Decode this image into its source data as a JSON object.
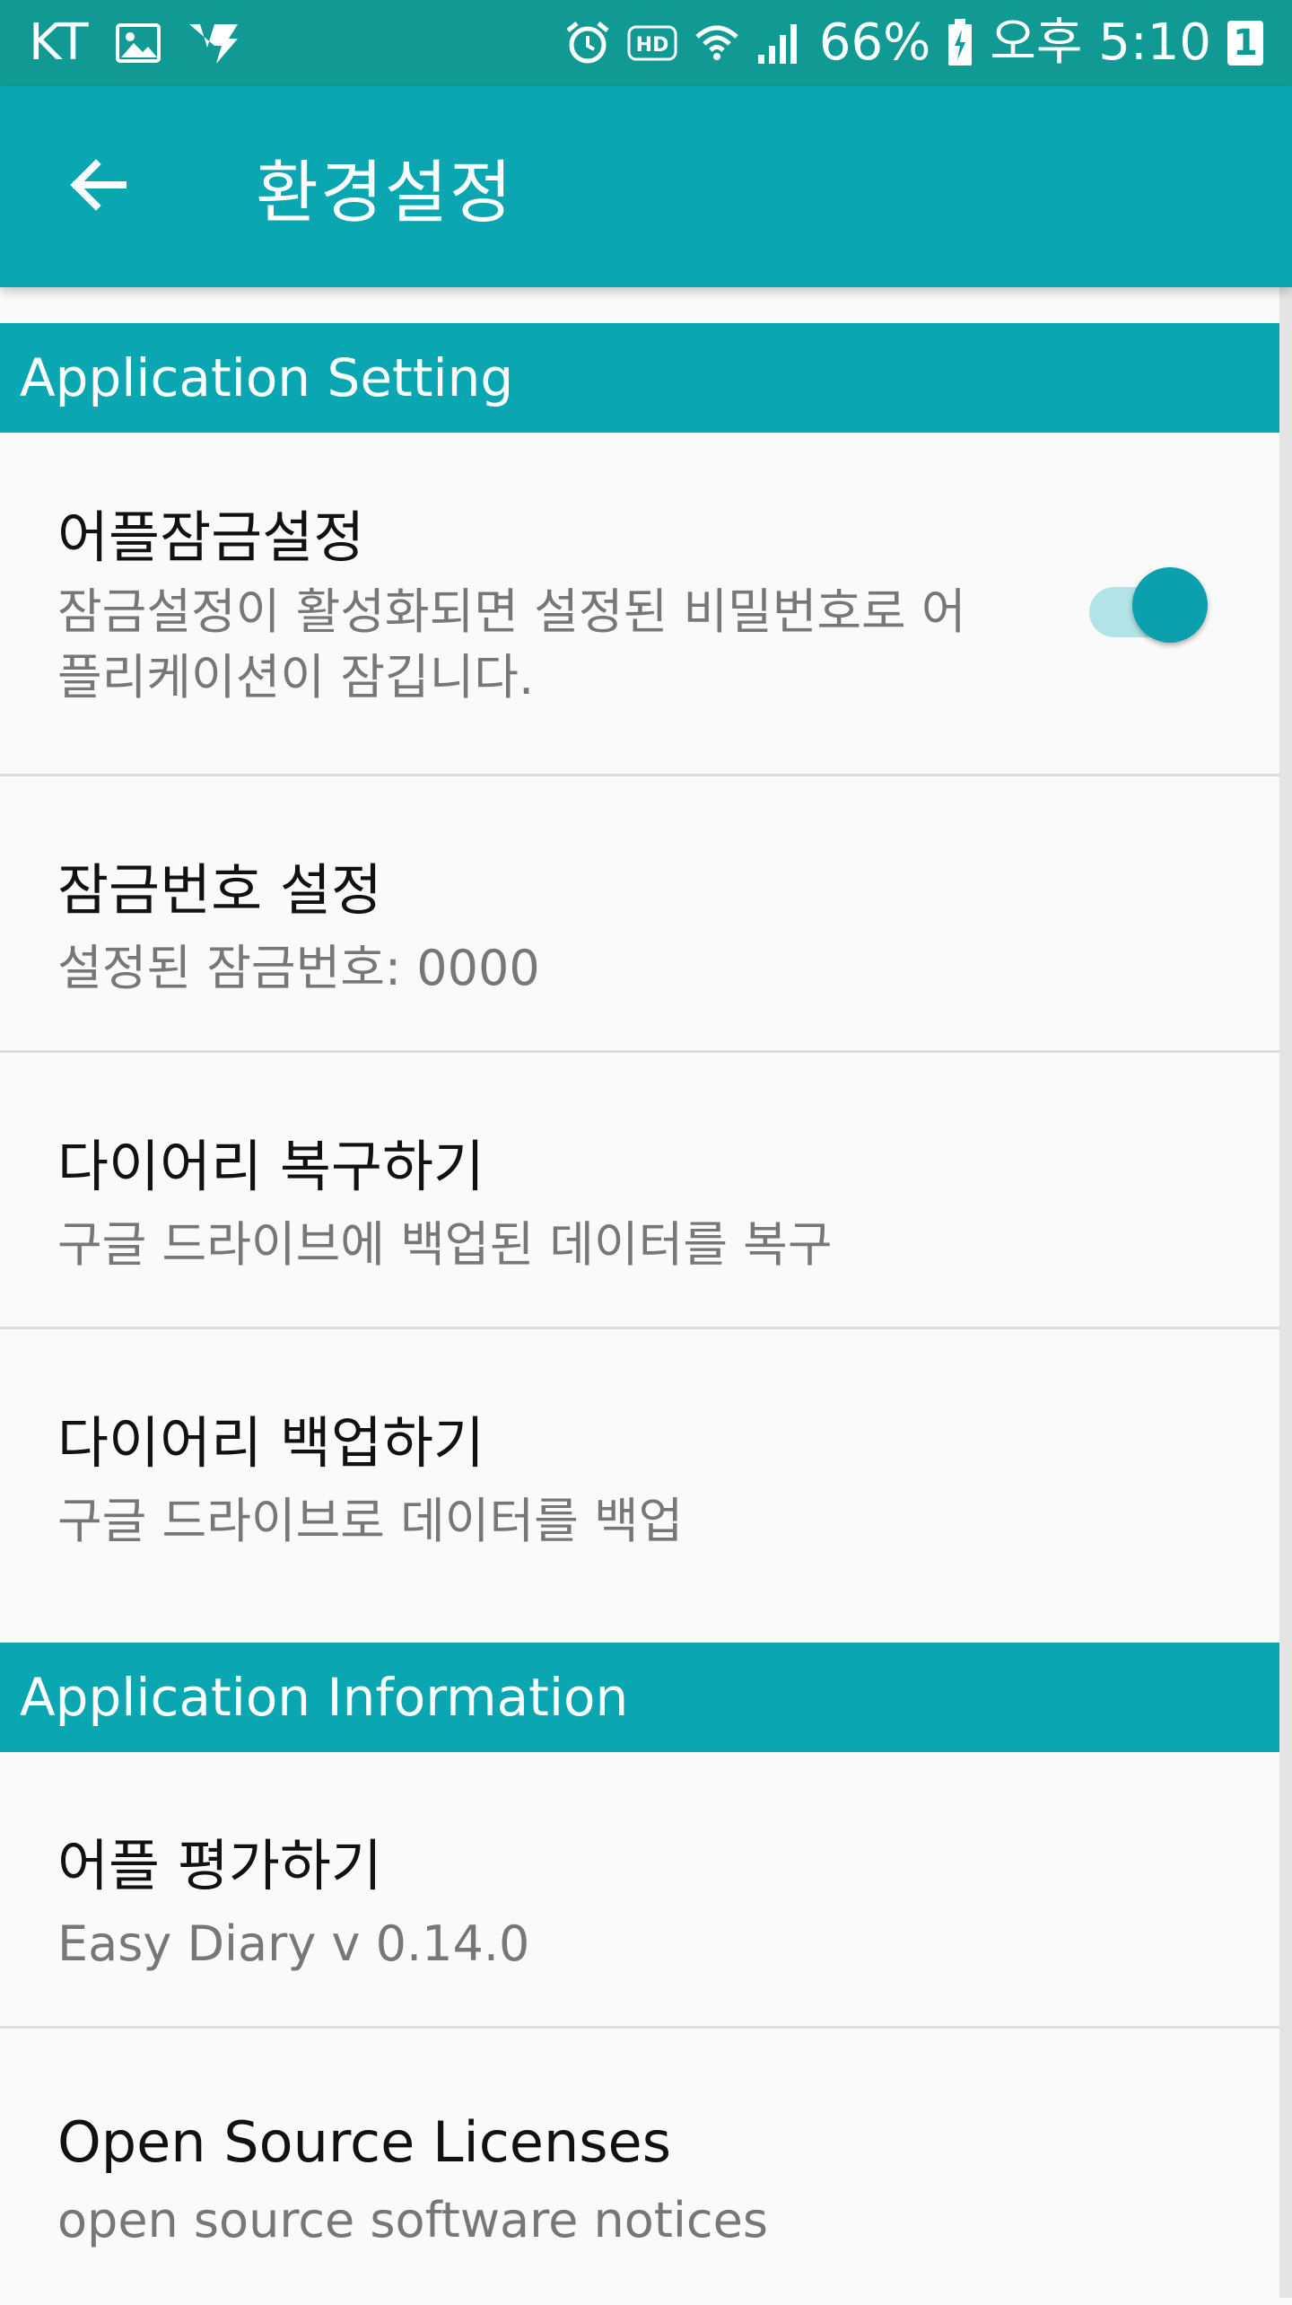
{
  "status_bar": {
    "carrier": "KT",
    "battery_percent": "66%",
    "time": "오후 5:10",
    "notification_count": "1",
    "icons": [
      "image-icon",
      "v-app-icon",
      "alarm-icon",
      "hd-icon",
      "wifi-icon",
      "signal-icon",
      "battery-icon"
    ]
  },
  "app_bar": {
    "title": "환경설정",
    "back_icon": "arrow-left-icon"
  },
  "sections": {
    "setting": {
      "header": "Application Setting",
      "items": {
        "lock": {
          "title": "어플잠금설정",
          "summary": "잠금설정이 활성화되면 설정된 비밀번호로 어플리케이션이 잠깁니다.",
          "enabled": true
        },
        "lock_number": {
          "title": "잠금번호 설정",
          "summary": "설정된 잠금번호: 0000"
        },
        "restore": {
          "title": "다이어리 복구하기",
          "summary": "구글 드라이브에 백업된 데이터를 복구"
        },
        "backup": {
          "title": "다이어리 백업하기",
          "summary": "구글 드라이브로 데이터를 백업"
        }
      }
    },
    "information": {
      "header": "Application Information",
      "items": {
        "rate": {
          "title": "어플 평가하기",
          "summary": "Easy Diary v 0.14.0"
        },
        "licenses": {
          "title": "Open Source Licenses",
          "summary": "open source software notices"
        }
      }
    }
  },
  "colors": {
    "status_bar": "#109a93",
    "primary": "#0aa7b2",
    "switch_thumb": "#0aa0ad",
    "switch_track": "#b2e3e6",
    "background": "#fafafa"
  }
}
